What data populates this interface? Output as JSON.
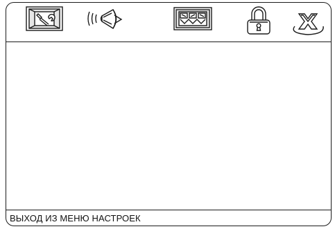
{
  "toolbar": {
    "icons": [
      "setup-icon",
      "audio-icon",
      "video-icon",
      "lock-icon",
      "exit-icon"
    ]
  },
  "status": {
    "text": "ВЫХОД ИЗ МЕНЮ НАСТРОЕК"
  },
  "colors": {
    "line": "#1a1a1a",
    "background": "#ffffff"
  }
}
